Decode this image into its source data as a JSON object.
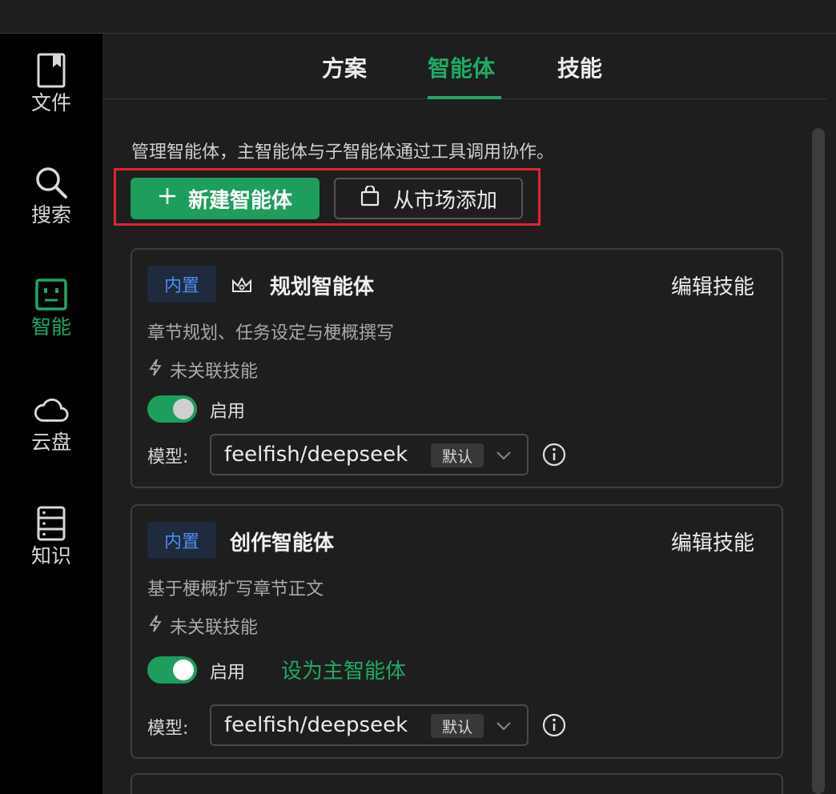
{
  "sidebar": {
    "items": [
      {
        "label": "文件",
        "icon": "bookmark-document-icon",
        "active": false
      },
      {
        "label": "搜索",
        "icon": "search-icon",
        "active": false
      },
      {
        "label": "智能",
        "icon": "robot-face-icon",
        "active": true
      },
      {
        "label": "云盘",
        "icon": "cloud-icon",
        "active": false
      },
      {
        "label": "知识",
        "icon": "database-icon",
        "active": false
      }
    ]
  },
  "tabs": [
    {
      "label": "方案",
      "active": false
    },
    {
      "label": "智能体",
      "active": true
    },
    {
      "label": "技能",
      "active": false
    }
  ],
  "description": "管理智能体，主智能体与子智能体通过工具调用协作。",
  "buttons": {
    "new_agent": "新建智能体",
    "add_from_market": "从市场添加"
  },
  "agents": [
    {
      "badge": "内置",
      "title": "规划智能体",
      "is_main": true,
      "edit_label": "编辑技能",
      "desc": "章节规划、任务设定与梗概撰写",
      "skills": "未关联技能",
      "enabled": true,
      "enable_label": "启用",
      "set_main_label": "",
      "model_label": "模型:",
      "model_value": "feelfish/deepseek",
      "model_tag": "默认"
    },
    {
      "badge": "内置",
      "title": "创作智能体",
      "is_main": false,
      "edit_label": "编辑技能",
      "desc": "基于梗概扩写章节正文",
      "skills": "未关联技能",
      "enabled": true,
      "enable_label": "启用",
      "set_main_label": "设为主智能体",
      "model_label": "模型:",
      "model_value": "feelfish/deepseek",
      "model_tag": "默认"
    }
  ],
  "colors": {
    "accent": "#1faa62",
    "highlight_border": "#e0242f",
    "badge_text": "#4a8ff0"
  }
}
